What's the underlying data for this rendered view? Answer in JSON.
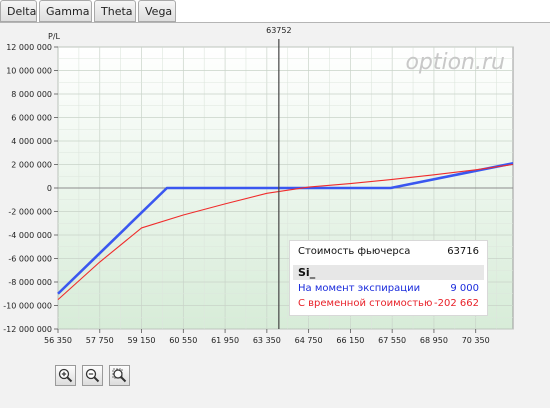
{
  "tabs": [
    {
      "label": "Delta"
    },
    {
      "label": "Gamma"
    },
    {
      "label": "Theta"
    },
    {
      "label": "Vega"
    }
  ],
  "watermark": "option.ru",
  "chart_data": {
    "type": "line",
    "ylabel": "P/L",
    "xlim": [
      56350,
      71600
    ],
    "ylim": [
      -12000000,
      12000000
    ],
    "x_ticks": [
      56350,
      57750,
      59150,
      60550,
      61950,
      63350,
      64750,
      66150,
      67550,
      68950,
      70350
    ],
    "x_tick_labels": [
      "56 350",
      "57 750",
      "59 150",
      "60 550",
      "61 950",
      "63 350",
      "64 750",
      "66 150",
      "67 550",
      "68 950",
      "70 350"
    ],
    "y_ticks": [
      12000000,
      10000000,
      8000000,
      6000000,
      4000000,
      2000000,
      0,
      -2000000,
      -4000000,
      -6000000,
      -8000000,
      -10000000,
      -12000000
    ],
    "y_tick_labels": [
      "12 000 000",
      "10 000 000",
      "8 000 000",
      "6 000 000",
      "4 000 000",
      "2 000 000",
      "0",
      "-2 000 000",
      "-4 000 000",
      "-6 000 000",
      "-8 000 000",
      "-10 000 000",
      "-12 000 000"
    ],
    "cursor": {
      "x": 63752,
      "label": "63752"
    },
    "series": [
      {
        "name": "На момент экспирации",
        "color": "#3a57f0",
        "x": [
          56350,
          60000,
          67500,
          71600
        ],
        "y": [
          -9000000,
          0,
          0,
          2100000
        ]
      },
      {
        "name": "С временной стоимостью",
        "color": "#f02c2c",
        "x": [
          56350,
          57750,
          59150,
          60550,
          61950,
          63350,
          64750,
          66150,
          67550,
          68950,
          70350,
          71600
        ],
        "y": [
          -9500000,
          -6300000,
          -3400000,
          -2300000,
          -1350000,
          -450000,
          80000,
          380000,
          730000,
          1120000,
          1550000,
          2000000
        ]
      }
    ]
  },
  "tooltip": {
    "futures_label": "Стоимость фьючерса",
    "futures_value": "63716",
    "instrument": "Si_",
    "expiry_label": "На момент экспирации",
    "expiry_value": "9 000",
    "time_label": "С временной стоимостью",
    "time_value": "-202 662"
  },
  "zoom": {
    "zoom_in_icon": "zoom-in-icon",
    "zoom_out_icon": "zoom-out-icon",
    "zoom_fit_icon": "zoom-fit-icon"
  }
}
